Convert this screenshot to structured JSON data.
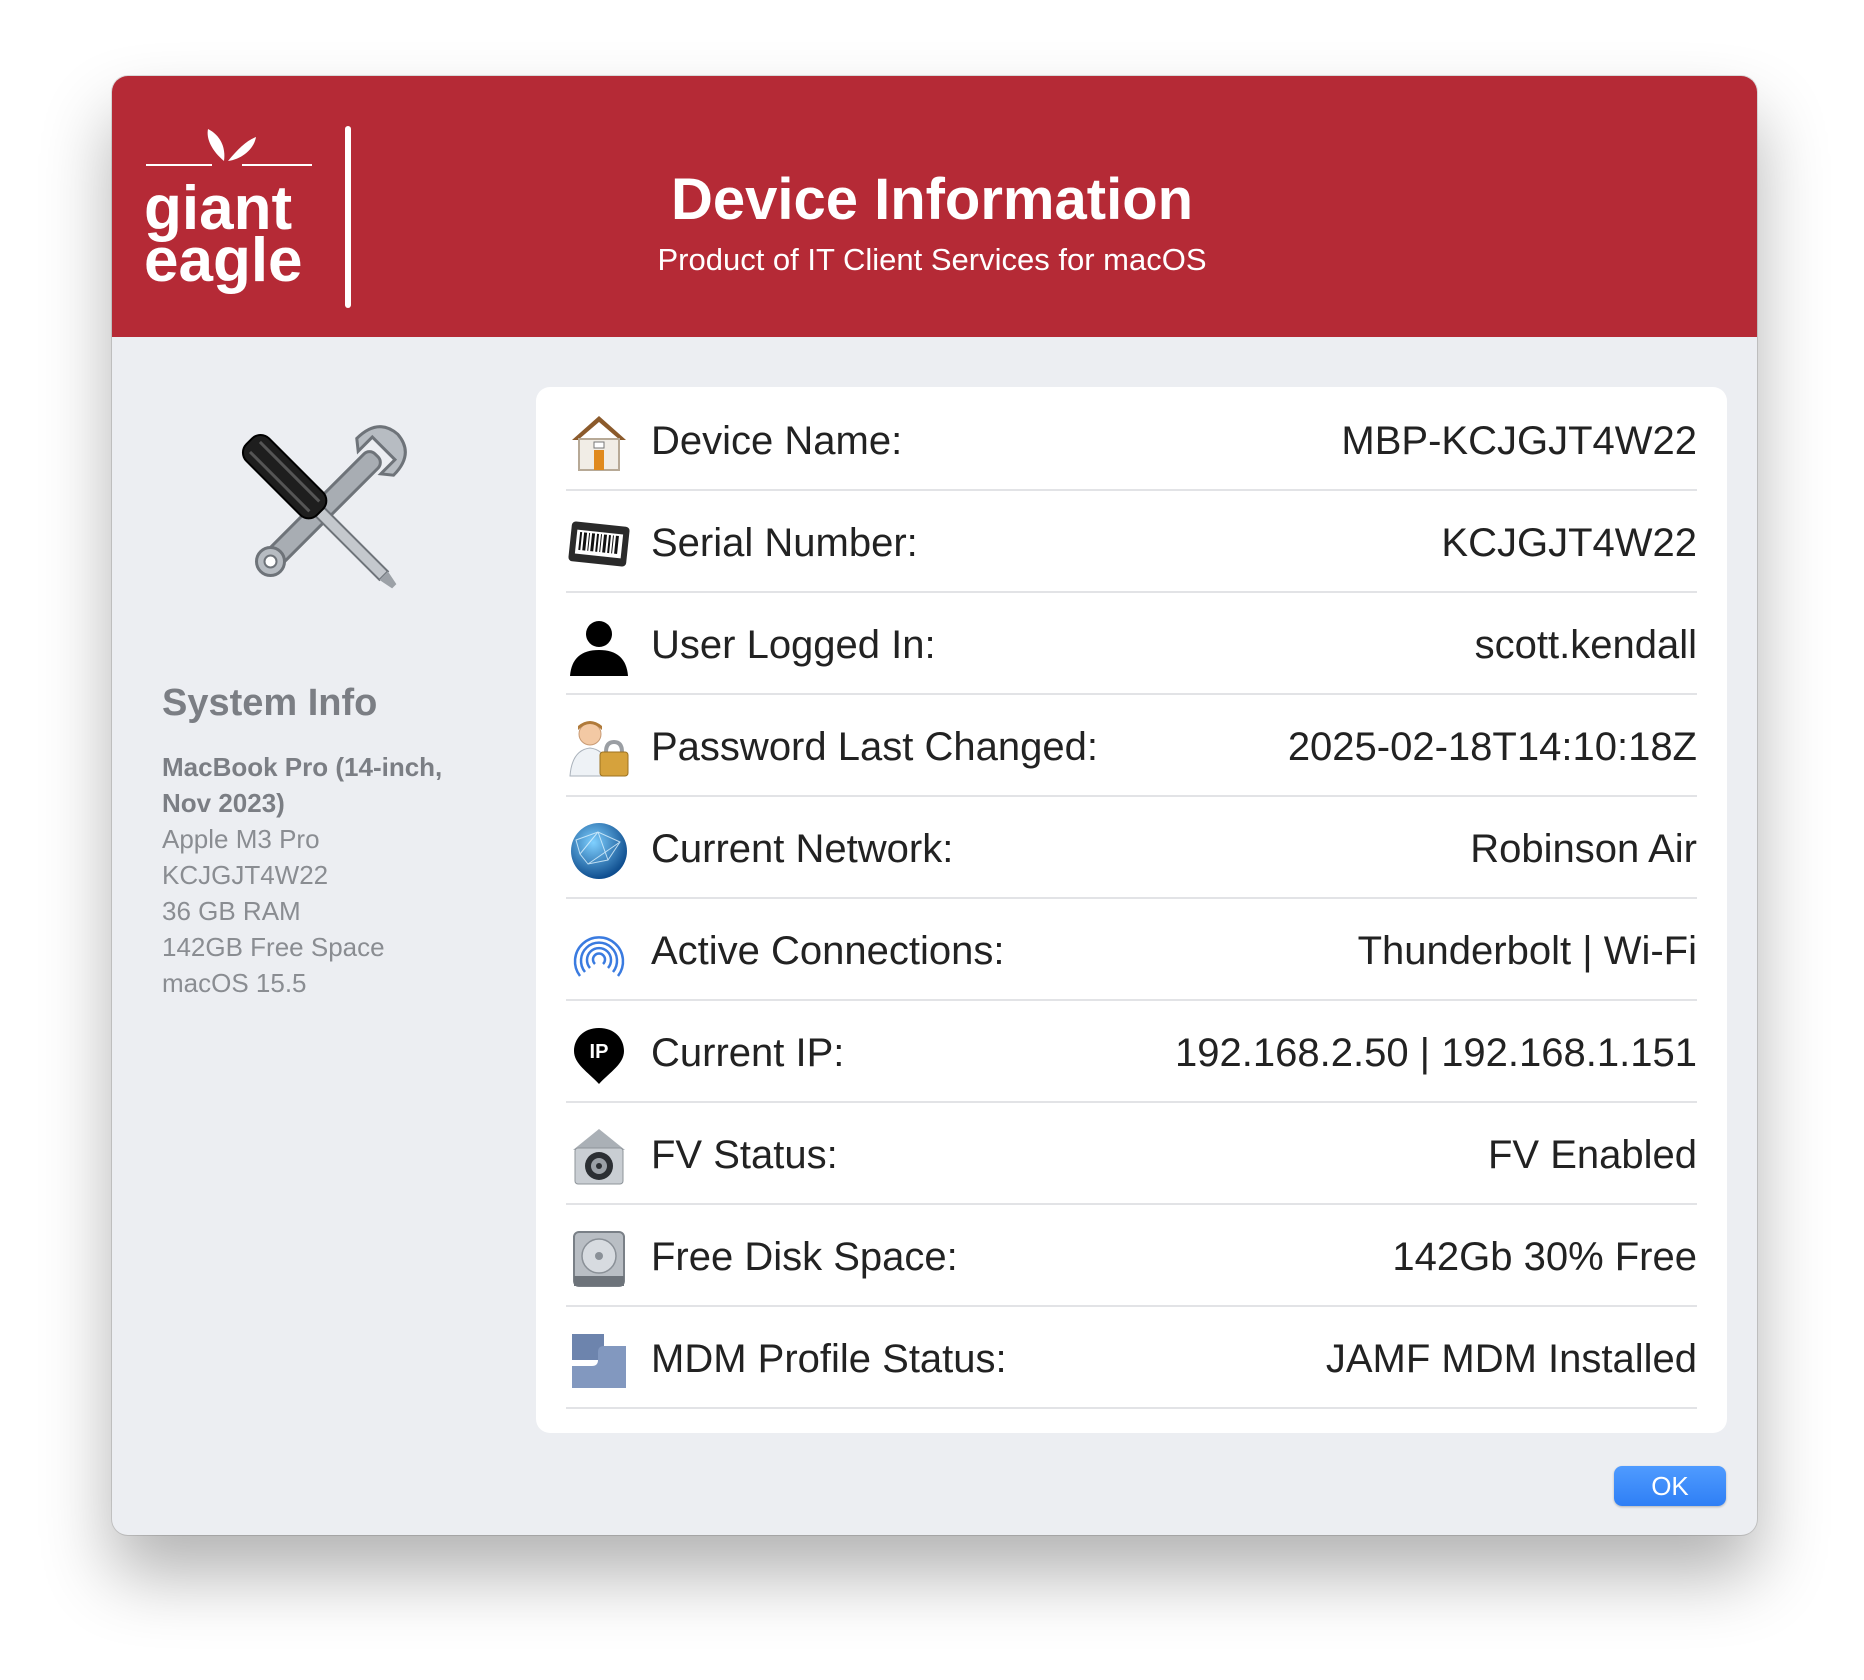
{
  "header": {
    "logo_text": [
      "giant",
      "eagle"
    ],
    "title": "Device Information",
    "subtitle": "Product of IT Client Services for macOS"
  },
  "sidebar": {
    "title": "System Info",
    "model_line1": "MacBook Pro (14-inch,",
    "model_line2": "Nov 2023)",
    "specs": [
      "Apple M3 Pro",
      "KCJGJT4W22",
      "36 GB RAM",
      "142GB Free Space",
      "macOS 15.5"
    ]
  },
  "rows": [
    {
      "icon": "house-icon",
      "label": "Device Name:",
      "value": "MBP-KCJGJT4W22"
    },
    {
      "icon": "barcode-icon",
      "label": "Serial Number:",
      "value": "KCJGJT4W22"
    },
    {
      "icon": "user-icon",
      "label": "User Logged In:",
      "value": "scott.kendall"
    },
    {
      "icon": "user-lock-icon",
      "label": "Password Last Changed:",
      "value": "2025-02-18T14:10:18Z"
    },
    {
      "icon": "globe-icon",
      "label": "Current Network:",
      "value": "Robinson Air"
    },
    {
      "icon": "airdrop-icon",
      "label": "Active Connections:",
      "value": "Thunderbolt | Wi-Fi"
    },
    {
      "icon": "ip-pin-icon",
      "label": "Current IP:",
      "value": "192.168.2.50 | 192.168.1.151"
    },
    {
      "icon": "filevault-icon",
      "label": "FV Status:",
      "value": "FV Enabled"
    },
    {
      "icon": "hard-disk-icon",
      "label": "Free Disk Space:",
      "value": "142Gb 30% Free"
    },
    {
      "icon": "mdm-profile-icon",
      "label": "MDM Profile Status:",
      "value": "JAMF MDM Installed"
    }
  ],
  "buttons": {
    "ok": "OK"
  },
  "colors": {
    "header_bg": "#b52a36",
    "ok_button": "#2f7ff5",
    "window_bg": "#eceef2"
  }
}
